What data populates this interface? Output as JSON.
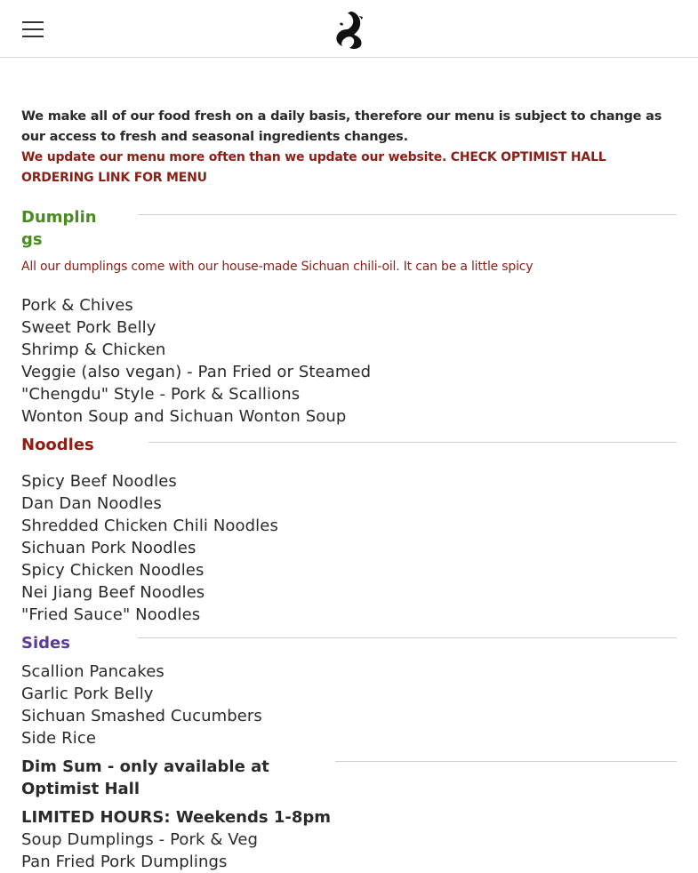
{
  "header": {
    "menu_icon": "hamburger-menu-icon",
    "logo_icon": "restaurant-logo-icon"
  },
  "intro": {
    "text": "We make all of our food fresh on a daily basis, therefore our menu is subject to change as our access to fresh and seasonal ingredients changes.",
    "notice": "We update our menu more often than we update our website. CHECK OPTIMIST HALL ORDERING LINK FOR MENU"
  },
  "sections": {
    "dumplings": {
      "title": "Dumplings",
      "color": "#4a8a22",
      "note": "All our dumplings come with our house-made Sichuan chili-oil. It can be a little spicy",
      "items": [
        "Pork & Chives",
        "Sweet Pork Belly",
        "Shrimp & Chicken",
        "Veggie (also vegan) - Pan Fried or Steamed",
        "\"Chengdu\" Style - Pork & Scallions",
        "Wonton Soup and Sichuan Wonton Soup"
      ]
    },
    "noodles": {
      "title": "Noodles",
      "color": "#8b1f16",
      "items": [
        "Spicy Beef Noodles",
        "Dan Dan Noodles",
        "Shredded Chicken Chili Noodles",
        "Sichuan Pork Noodles",
        "Spicy Chicken Noodles",
        "Nei Jiang Beef Noodles",
        "\"Fried Sauce\" Noodles"
      ]
    },
    "sides": {
      "title": "Sides",
      "color": "#5a3d96",
      "items": [
        "Scallion Pancakes",
        "Garlic Pork Belly",
        "Sichuan Smashed Cucumbers",
        "Side Rice"
      ]
    },
    "dimsum": {
      "title": "Dim Sum - only available at Optimist Hall",
      "color": "#2a2a2a",
      "hours": "LIMITED HOURS: Weekends 1-8pm",
      "items": [
        "Soup Dumplings - Pork & Veg",
        "Pan Fried Pork Dumplings"
      ]
    }
  }
}
